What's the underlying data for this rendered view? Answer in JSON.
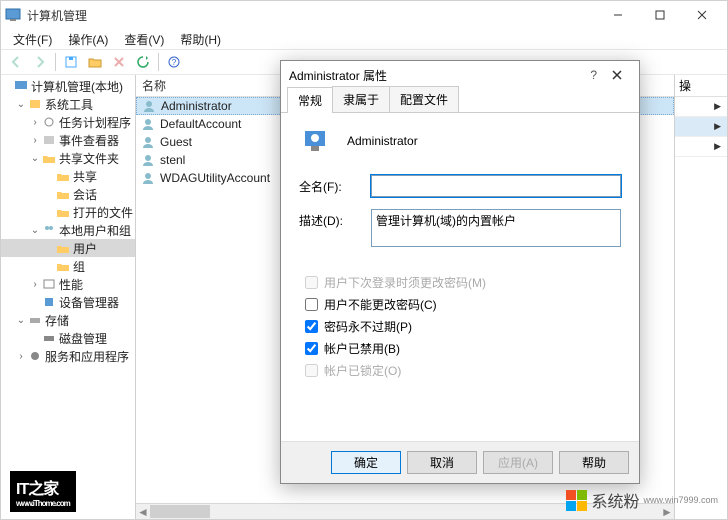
{
  "window": {
    "title": "计算机管理"
  },
  "menubar": {
    "file": "文件(F)",
    "action": "操作(A)",
    "view": "查看(V)",
    "help": "帮助(H)"
  },
  "tree": {
    "root": "计算机管理(本地)",
    "system_tools": "系统工具",
    "task_scheduler": "任务计划程序",
    "event_viewer": "事件查看器",
    "shared_folders": "共享文件夹",
    "shares": "共享",
    "sessions": "会话",
    "open_files": "打开的文件",
    "local_users": "本地用户和组",
    "users": "用户",
    "groups": "组",
    "performance": "性能",
    "device_mgr": "设备管理器",
    "storage": "存储",
    "disk_mgmt": "磁盘管理",
    "services_apps": "服务和应用程序"
  },
  "column": {
    "name": "名称"
  },
  "users": {
    "administrator": "Administrator",
    "default_account": "DefaultAccount",
    "guest": "Guest",
    "stenl": "stenl",
    "wdag": "WDAGUtilityAccount"
  },
  "actions": {
    "header": "操"
  },
  "dialog": {
    "title": "Administrator 属性",
    "tabs": {
      "general": "常规",
      "member_of": "隶属于",
      "profile": "配置文件"
    },
    "user_name": "Administrator",
    "full_name_label": "全名(F):",
    "full_name_value": "",
    "description_label": "描述(D):",
    "description_value": "管理计算机(域)的内置帐户",
    "must_change": "用户下次登录时须更改密码(M)",
    "cannot_change": "用户不能更改密码(C)",
    "never_expires": "密码永不过期(P)",
    "disabled": "帐户已禁用(B)",
    "locked": "帐户已锁定(O)",
    "ok": "确定",
    "cancel": "取消",
    "apply": "应用(A)",
    "help": "帮助"
  },
  "watermarks": {
    "ithome": "IT之家",
    "ithome_url": "www.iThome.com",
    "xitong": "系统粉",
    "xitong_url": "www.win7999.com"
  }
}
